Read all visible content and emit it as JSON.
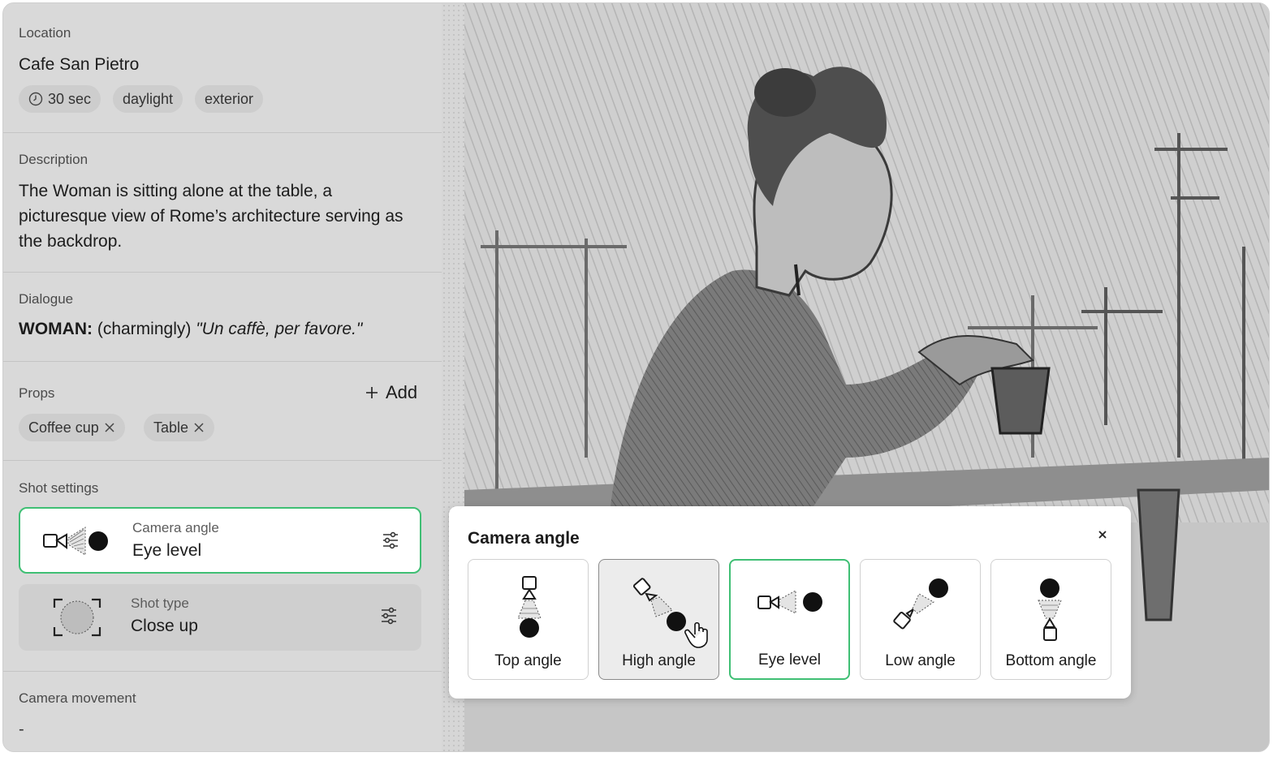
{
  "location": {
    "label": "Location",
    "name": "Cafe San Pietro",
    "tags": [
      "30 sec",
      "daylight",
      "exterior"
    ]
  },
  "description": {
    "label": "Description",
    "text": "The Woman is sitting alone at the table, a picturesque view of Rome’s architecture serving as the backdrop."
  },
  "dialogue": {
    "label": "Dialogue",
    "speaker": "WOMAN:",
    "direction": "(charmingly)",
    "line": "\"Un caffè, per favore.\""
  },
  "props": {
    "label": "Props",
    "add_label": "Add",
    "items": [
      "Coffee cup",
      "Table"
    ]
  },
  "shot_settings": {
    "label": "Shot settings",
    "camera_angle": {
      "label": "Camera angle",
      "value": "Eye level"
    },
    "shot_type": {
      "label": "Shot type",
      "value": "Close up"
    }
  },
  "camera_movement": {
    "label": "Camera movement",
    "value": "-"
  },
  "popover": {
    "title": "Camera angle",
    "options": [
      "Top angle",
      "High angle",
      "Eye level",
      "Low angle",
      "Bottom angle"
    ],
    "selected": "Eye level",
    "hovered": "High angle"
  },
  "colors": {
    "accent": "#3fbf74",
    "panel_bg": "#d9d9d9",
    "chip_bg": "#cdcdcd"
  }
}
